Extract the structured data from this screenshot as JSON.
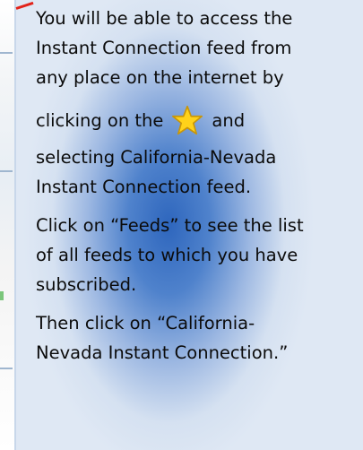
{
  "callout": {
    "paragraph1": {
      "line1": "You will be able to access the",
      "line2": "Instant Connection feed from",
      "line3": "any place on the internet by",
      "line4_pre": "clicking on the",
      "line4_post": "and",
      "line5": "selecting California-Nevada",
      "line6": "Instant Connection feed."
    },
    "paragraph2": {
      "line1": "Click on “Feeds”  to see the list",
      "line2": "of all feeds to which you have",
      "line3": "subscribed."
    },
    "paragraph3": {
      "line1": "Then click on “California-",
      "line2": "Nevada Instant Connection.”"
    },
    "star_icon": "favorites-star-icon",
    "colors": {
      "pointer": "#e2231a",
      "star_fill": "#ffd21a",
      "star_outline": "#c8960a",
      "glow": "#2e66bd"
    }
  }
}
